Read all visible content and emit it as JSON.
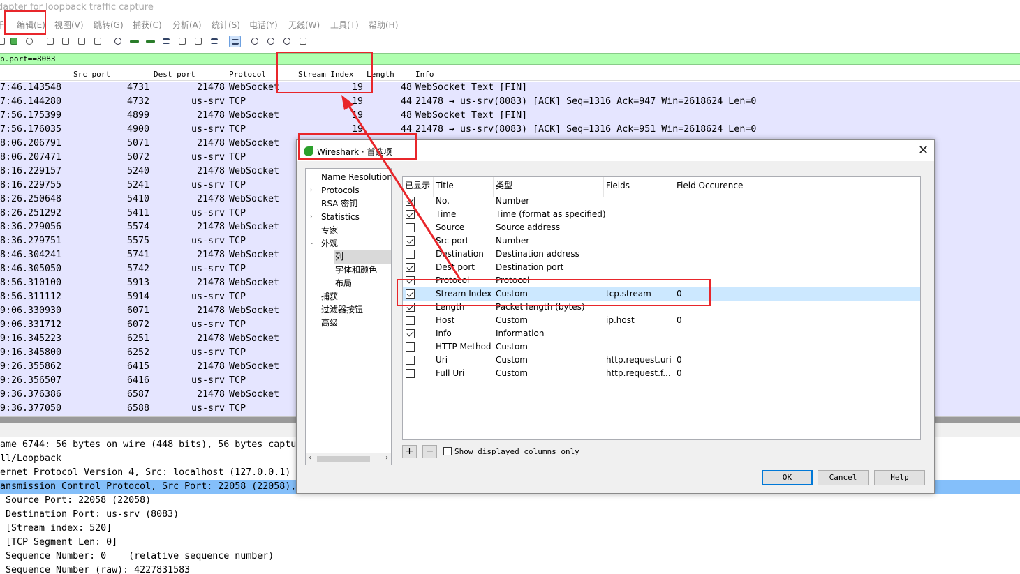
{
  "window": {
    "title": "dapter for loopback traffic capture",
    "menu": [
      "千",
      "编辑(E)",
      "视图(V)",
      "跳转(G)",
      "捕获(C)",
      "分析(A)",
      "统计(S)",
      "电话(Y)",
      "无线(W)",
      "工具(T)",
      "帮助(H)"
    ],
    "display_filter": "p.port==8083"
  },
  "packet_list": {
    "columns": [
      "Src port",
      "Dest port",
      "Protocol",
      "Stream Index",
      "Length",
      "Info"
    ],
    "rows": [
      {
        "time": "7:46.143548",
        "src": "4731",
        "dst": "21478",
        "proto": "WebSocket",
        "sidx": "19",
        "len": "48",
        "info": "WebSocket Text [FIN]"
      },
      {
        "time": "7:46.144280",
        "src": "4732",
        "dst": "us-srv",
        "proto": "TCP",
        "sidx": "19",
        "len": "44",
        "info": "21478 → us-srv(8083) [ACK] Seq=1316 Ack=947 Win=2618624 Len=0"
      },
      {
        "time": "7:56.175399",
        "src": "4899",
        "dst": "21478",
        "proto": "WebSocket",
        "sidx": "19",
        "len": "48",
        "info": "WebSocket Text [FIN]"
      },
      {
        "time": "7:56.176035",
        "src": "4900",
        "dst": "us-srv",
        "proto": "TCP",
        "sidx": "19",
        "len": "44",
        "info": "21478 → us-srv(8083) [ACK] Seq=1316 Ack=951 Win=2618624 Len=0"
      },
      {
        "time": "8:06.206791",
        "src": "5071",
        "dst": "21478",
        "proto": "WebSocket",
        "sidx": "",
        "len": "",
        "info": ""
      },
      {
        "time": "8:06.207471",
        "src": "5072",
        "dst": "us-srv",
        "proto": "TCP",
        "sidx": "",
        "len": "",
        "info": ""
      },
      {
        "time": "8:16.229157",
        "src": "5240",
        "dst": "21478",
        "proto": "WebSocket",
        "sidx": "",
        "len": "",
        "info": ""
      },
      {
        "time": "8:16.229755",
        "src": "5241",
        "dst": "us-srv",
        "proto": "TCP",
        "sidx": "",
        "len": "",
        "info": ""
      },
      {
        "time": "8:26.250648",
        "src": "5410",
        "dst": "21478",
        "proto": "WebSocket",
        "sidx": "",
        "len": "",
        "info": ""
      },
      {
        "time": "8:26.251292",
        "src": "5411",
        "dst": "us-srv",
        "proto": "TCP",
        "sidx": "",
        "len": "",
        "info": ""
      },
      {
        "time": "8:36.279056",
        "src": "5574",
        "dst": "21478",
        "proto": "WebSocket",
        "sidx": "",
        "len": "",
        "info": ""
      },
      {
        "time": "8:36.279751",
        "src": "5575",
        "dst": "us-srv",
        "proto": "TCP",
        "sidx": "",
        "len": "",
        "info": ""
      },
      {
        "time": "8:46.304241",
        "src": "5741",
        "dst": "21478",
        "proto": "WebSocket",
        "sidx": "",
        "len": "",
        "info": ""
      },
      {
        "time": "8:46.305050",
        "src": "5742",
        "dst": "us-srv",
        "proto": "TCP",
        "sidx": "",
        "len": "",
        "info": ""
      },
      {
        "time": "8:56.310100",
        "src": "5913",
        "dst": "21478",
        "proto": "WebSocket",
        "sidx": "",
        "len": "",
        "info": ""
      },
      {
        "time": "8:56.311112",
        "src": "5914",
        "dst": "us-srv",
        "proto": "TCP",
        "sidx": "",
        "len": "",
        "info": ""
      },
      {
        "time": "9:06.330930",
        "src": "6071",
        "dst": "21478",
        "proto": "WebSocket",
        "sidx": "",
        "len": "",
        "info": ""
      },
      {
        "time": "9:06.331712",
        "src": "6072",
        "dst": "us-srv",
        "proto": "TCP",
        "sidx": "",
        "len": "",
        "info": ""
      },
      {
        "time": "9:16.345223",
        "src": "6251",
        "dst": "21478",
        "proto": "WebSocket",
        "sidx": "",
        "len": "",
        "info": ""
      },
      {
        "time": "9:16.345800",
        "src": "6252",
        "dst": "us-srv",
        "proto": "TCP",
        "sidx": "",
        "len": "",
        "info": ""
      },
      {
        "time": "9:26.355862",
        "src": "6415",
        "dst": "21478",
        "proto": "WebSocket",
        "sidx": "",
        "len": "",
        "info": ""
      },
      {
        "time": "9:26.356507",
        "src": "6416",
        "dst": "us-srv",
        "proto": "TCP",
        "sidx": "",
        "len": "",
        "info": ""
      },
      {
        "time": "9:36.376386",
        "src": "6587",
        "dst": "21478",
        "proto": "WebSocket",
        "sidx": "",
        "len": "",
        "info": ""
      },
      {
        "time": "9:36.377050",
        "src": "6588",
        "dst": "us-srv",
        "proto": "TCP",
        "sidx": "",
        "len": "",
        "info": ""
      }
    ]
  },
  "packet_details": [
    "ame 6744: 56 bytes on wire (448 bits), 56 bytes captu",
    "ll/Loopback",
    "ernet Protocol Version 4, Src: localhost (127.0.0.1)",
    "ansmission Control Protocol, Src Port: 22058 (22058),",
    " Source Port: 22058 (22058)",
    " Destination Port: us-srv (8083)",
    " [Stream index: 520]",
    " [TCP Segment Len: 0]",
    " Sequence Number: 0    (relative sequence number)",
    " Sequence Number (raw): 4227831583"
  ],
  "dialog": {
    "title": "Wireshark · 首选项",
    "tree": [
      "Name Resolution",
      "Protocols",
      "RSA 密钥",
      "Statistics",
      "专家",
      "外观",
      "列",
      "字体和颜色",
      "布局",
      "捕获",
      "过滤器按钮",
      "高级"
    ],
    "headers": [
      "已显示",
      "Title",
      "类型",
      "Fields",
      "Field Occurence"
    ],
    "columns": [
      {
        "on": true,
        "title": "No.",
        "type": "Number",
        "fields": "",
        "occ": ""
      },
      {
        "on": true,
        "title": "Time",
        "type": "Time (format as specified)",
        "fields": "",
        "occ": ""
      },
      {
        "on": false,
        "title": "Source",
        "type": "Source address",
        "fields": "",
        "occ": ""
      },
      {
        "on": true,
        "title": "Src port",
        "type": "Number",
        "fields": "",
        "occ": ""
      },
      {
        "on": false,
        "title": "Destination",
        "type": "Destination address",
        "fields": "",
        "occ": ""
      },
      {
        "on": true,
        "title": "Dest port",
        "type": "Destination port",
        "fields": "",
        "occ": ""
      },
      {
        "on": true,
        "title": "Protocol",
        "type": "Protocol",
        "fields": "",
        "occ": ""
      },
      {
        "on": true,
        "title": "Stream Index",
        "type": "Custom",
        "fields": "tcp.stream",
        "occ": "0"
      },
      {
        "on": true,
        "title": "Length",
        "type": "Packet length (bytes)",
        "fields": "",
        "occ": ""
      },
      {
        "on": false,
        "title": "Host",
        "type": "Custom",
        "fields": "ip.host",
        "occ": "0"
      },
      {
        "on": true,
        "title": "Info",
        "type": "Information",
        "fields": "",
        "occ": ""
      },
      {
        "on": false,
        "title": "HTTP Method",
        "type": "Custom",
        "fields": "",
        "occ": ""
      },
      {
        "on": false,
        "title": "Uri",
        "type": "Custom",
        "fields": "http.request.uri",
        "occ": "0"
      },
      {
        "on": false,
        "title": "Full Uri",
        "type": "Custom",
        "fields": "http.request.f...",
        "occ": "0"
      }
    ],
    "add": "+",
    "remove": "−",
    "show_only_label": "Show displayed columns only",
    "ok": "OK",
    "cancel": "Cancel",
    "help": "Help",
    "close": "✕"
  },
  "colors": {
    "annotation": "#e8262b",
    "packet_bg": "#e5e5ff",
    "filter_bg": "#afffaf",
    "selected_row": "#cce8ff"
  }
}
